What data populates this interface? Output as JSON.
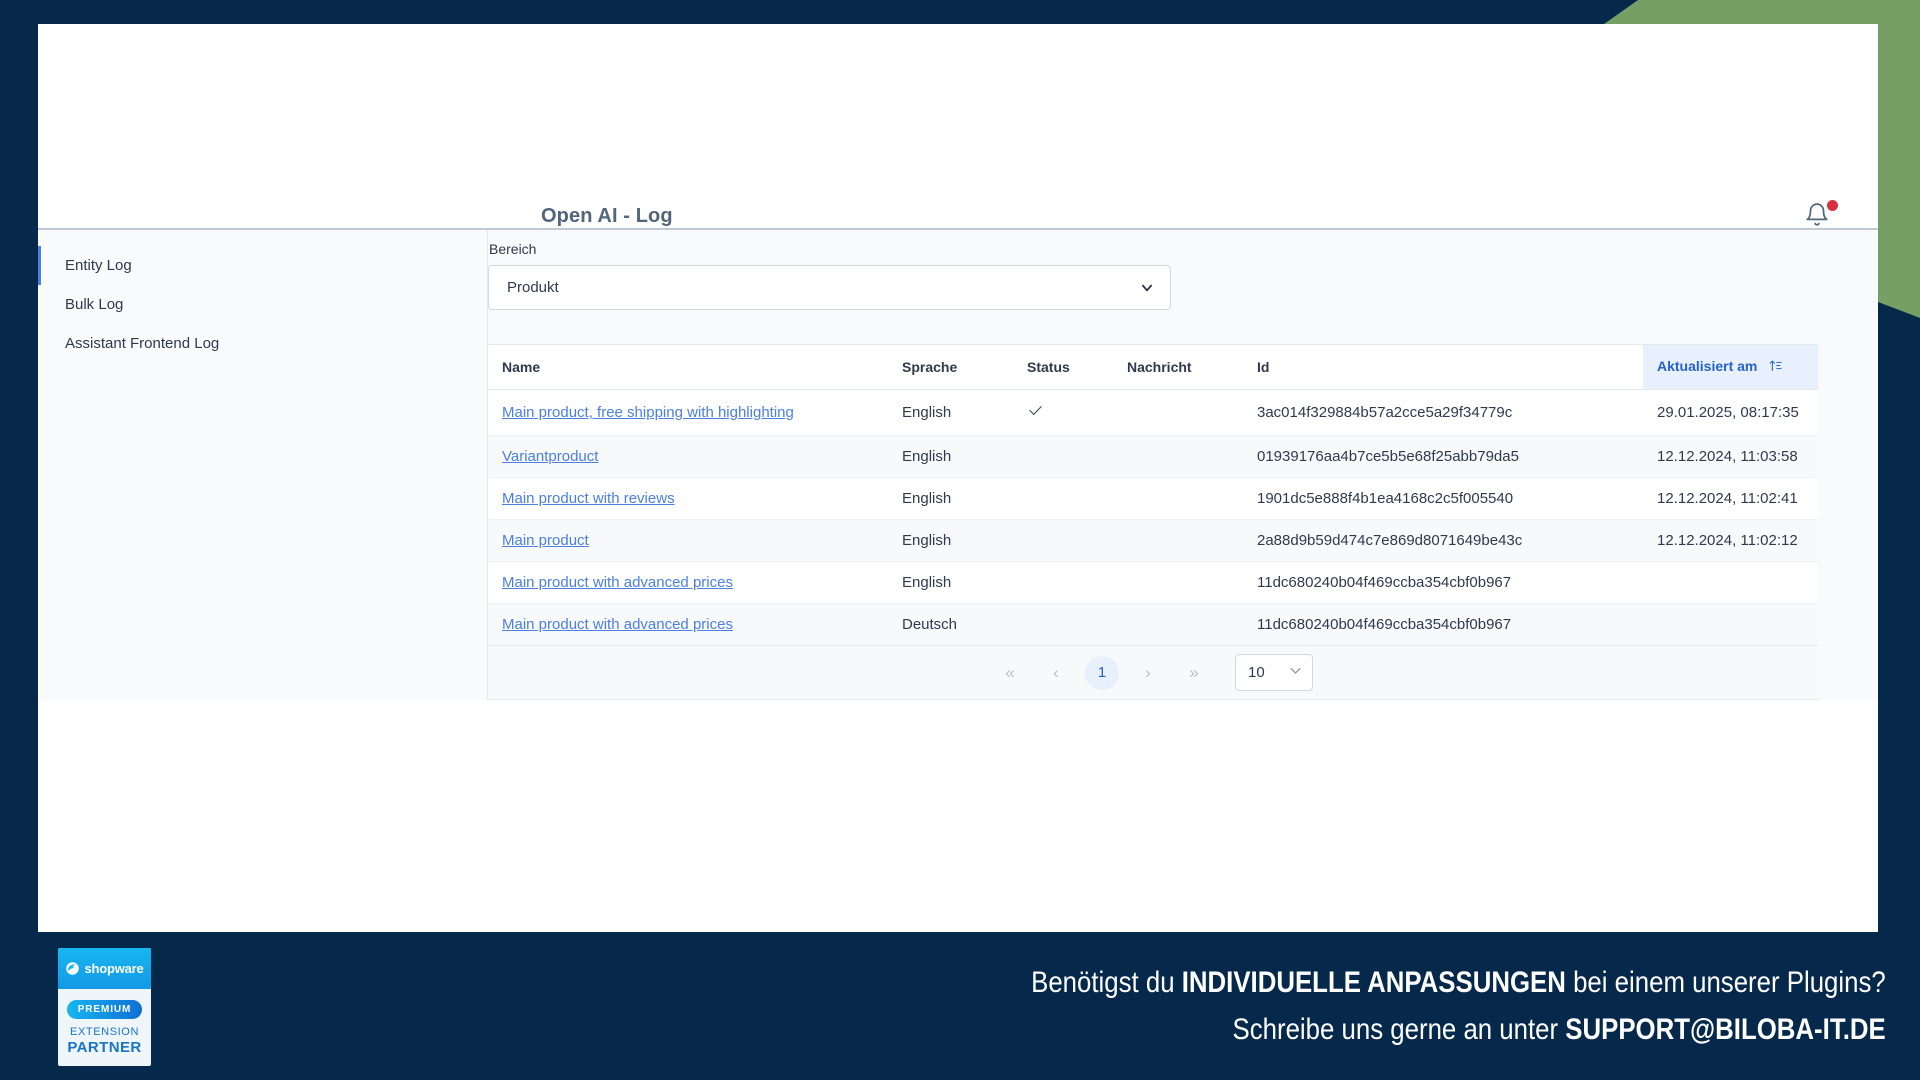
{
  "window": {
    "title": "Open AI - Log",
    "accent_blue": "#4b7fe0",
    "frame_navy": "#05284b",
    "frame_green": "#769f66"
  },
  "topbar": {
    "title": "Open AI - Log",
    "notification_icon": "bell-icon",
    "has_unread": true
  },
  "sidebar": {
    "items": [
      {
        "label": "Entity Log",
        "active": true
      },
      {
        "label": "Bulk Log",
        "active": false
      },
      {
        "label": "Assistant Frontend Log",
        "active": false
      }
    ]
  },
  "filter": {
    "label": "Bereich",
    "selected": "Produkt",
    "caret_icon": "chevron-down-icon"
  },
  "table": {
    "columns": [
      {
        "key": "name",
        "label": "Name",
        "sorted": false
      },
      {
        "key": "sprache",
        "label": "Sprache",
        "sorted": false
      },
      {
        "key": "status",
        "label": "Status",
        "sorted": false
      },
      {
        "key": "nachricht",
        "label": "Nachricht",
        "sorted": false
      },
      {
        "key": "id",
        "label": "Id",
        "sorted": false
      },
      {
        "key": "aktualisiert",
        "label": "Aktualisiert am",
        "sorted": true,
        "sort_icon": "sort-ascending-icon"
      }
    ],
    "rows": [
      {
        "name": "Main product, free shipping with highlighting",
        "sprache": "English",
        "status": "check",
        "nachricht": "",
        "id": "3ac014f329884b57a2cce5a29f34779c",
        "aktualisiert": "29.01.2025, 08:17:35"
      },
      {
        "name": "Variantproduct",
        "sprache": "English",
        "status": "",
        "nachricht": "",
        "id": "01939176aa4b7ce5b5e68f25abb79da5",
        "aktualisiert": "12.12.2024, 11:03:58"
      },
      {
        "name": "Main product with reviews",
        "sprache": "English",
        "status": "",
        "nachricht": "",
        "id": "1901dc5e888f4b1ea4168c2c5f005540",
        "aktualisiert": "12.12.2024, 11:02:41"
      },
      {
        "name": "Main product",
        "sprache": "English",
        "status": "",
        "nachricht": "",
        "id": "2a88d9b59d474c7e869d8071649be43c",
        "aktualisiert": "12.12.2024, 11:02:12"
      },
      {
        "name": "Main product with advanced prices",
        "sprache": "English",
        "status": "",
        "nachricht": "",
        "id": "11dc680240b04f469ccba354cbf0b967",
        "aktualisiert": ""
      },
      {
        "name": "Main product with advanced prices",
        "sprache": "Deutsch",
        "status": "",
        "nachricht": "",
        "id": "11dc680240b04f469ccba354cbf0b967",
        "aktualisiert": ""
      }
    ]
  },
  "pagination": {
    "first_label": "«",
    "prev_label": "‹",
    "current_page": "1",
    "next_label": "›",
    "last_label": "»",
    "page_size": "10",
    "page_size_caret": "chevron-down-icon"
  },
  "banner": {
    "badge": {
      "brand": "shopware",
      "premium": "PREMIUM",
      "extension": "EXTENSION",
      "partner": "PARTNER"
    },
    "line1_pre": "Benötigst du ",
    "line1_strong": "INDIVIDUELLE ANPASSUNGEN",
    "line1_post": " bei einem unserer Plugins?",
    "line2_pre": "Schreibe uns gerne an unter ",
    "line2_strong": "SUPPORT@BILOBA-IT.DE"
  }
}
